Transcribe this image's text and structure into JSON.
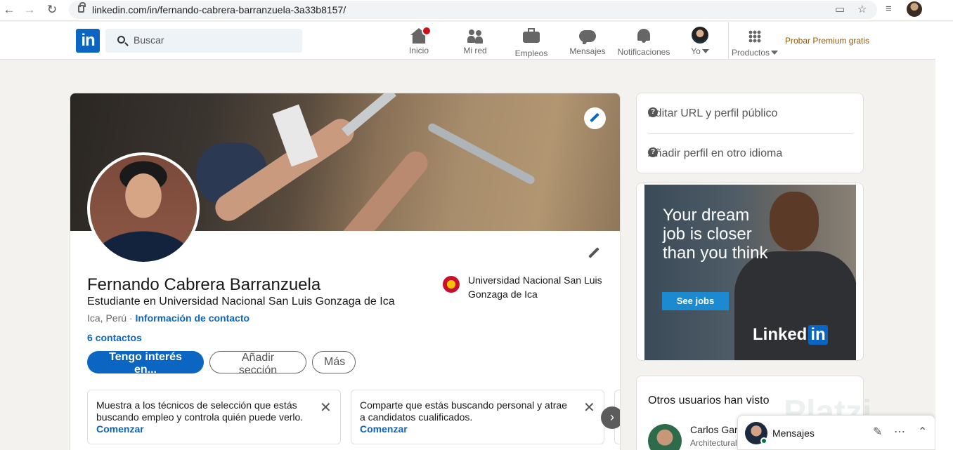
{
  "browser": {
    "url": "linkedin.com/in/fernando-cabrera-barranzuela-3a33b8157/",
    "back_icon": "arrow-left-icon",
    "forward_icon": "arrow-right-icon",
    "reload_icon": "reload-icon"
  },
  "header": {
    "search_placeholder": "Buscar",
    "nav": [
      {
        "label": "Inicio",
        "icon": "home-icon"
      },
      {
        "label": "Mi red",
        "icon": "network-icon"
      },
      {
        "label": "Empleos",
        "icon": "briefcase-icon"
      },
      {
        "label": "Mensajes",
        "icon": "messaging-icon"
      },
      {
        "label": "Notificaciones",
        "icon": "bell-icon"
      },
      {
        "label": "Yo",
        "icon": "avatar"
      },
      {
        "label": "Productos",
        "icon": "grid-icon"
      }
    ],
    "premium": "Probar Premium gratis",
    "logo_text": "in"
  },
  "profile": {
    "name": "Fernando Cabrera Barranzuela",
    "headline": "Estudiante en Universidad Nacional San Luis Gonzaga de Ica",
    "location": "Ica, Perú ·",
    "contact_info": "Información de contacto",
    "connections": "6 contactos",
    "university": "Universidad Nacional San Luis Gonzaga de Ica",
    "buttons": {
      "primary": "Tengo interés en...",
      "add_section": "Añadir sección",
      "more": "Más"
    },
    "tips": [
      {
        "text_bold": "Muestra a los técnicos de selección que estás buscando empleo",
        "text_rest": " y controla quién puede verlo.",
        "cta": "Comenzar"
      },
      {
        "text_bold": "Comparte que estás buscando personal",
        "text_rest": " y atrae a candidatos cualificados.",
        "cta": "Comenzar"
      }
    ]
  },
  "sidebar": {
    "edit_url": "Editar URL y perfil público",
    "add_language": "Añadir perfil en otro idioma",
    "ad": {
      "text": "Your dream job is closer than you think",
      "button": "See jobs",
      "logo_word": "Linked",
      "logo_in": "in"
    },
    "others_viewed": "Otros usuarios han visto",
    "person": {
      "name": "Carlos Garc",
      "subtitle": "Architectural"
    }
  },
  "messaging": {
    "label": "Mensajes"
  },
  "watermark": "Platzi",
  "colors": {
    "brand": "#0a66c2",
    "background": "#f3f2ef",
    "premium": "#915907",
    "notification": "#cc1016"
  }
}
